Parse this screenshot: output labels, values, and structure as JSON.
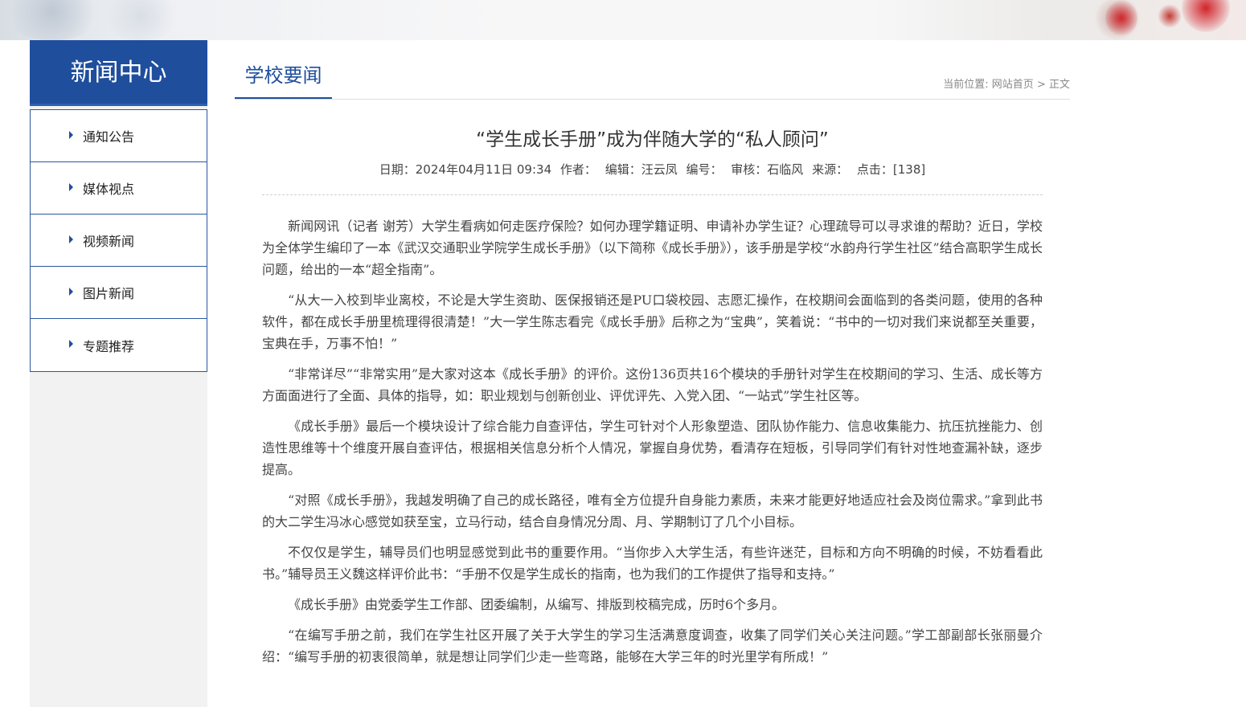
{
  "sidebar": {
    "title": "新闻中心",
    "items": [
      {
        "label": "通知公告"
      },
      {
        "label": "媒体视点"
      },
      {
        "label": "视频新闻"
      },
      {
        "label": "图片新闻"
      },
      {
        "label": "专题推荐"
      }
    ]
  },
  "section": {
    "title": "学校要闻"
  },
  "breadcrumb": {
    "prefix": "当前位置: ",
    "home": "网站首页",
    "separator": " > ",
    "current": "正文"
  },
  "article": {
    "title": "“学生成长手册”成为伴随大学的“私人顾问”",
    "meta": {
      "date": "日期：2024年04月11日 09:34",
      "author": "作者：",
      "editor": "编辑：汪云凤",
      "number": "编号：",
      "reviewer": "审核：石临风",
      "source": "来源：",
      "clicks": "点击：[138]"
    },
    "paragraphs": [
      "新闻网讯（记者 谢芳）大学生看病如何走医疗保险？如何办理学籍证明、申请补办学生证？心理疏导可以寻求谁的帮助？近日，学校为全体学生编印了一本《武汉交通职业学院学生成长手册》（以下简称《成长手册》），该手册是学校“水韵舟行学生社区”结合高职学生成长问题，给出的一本“超全指南”。",
      "“从大一入校到毕业离校，不论是大学生资助、医保报销还是PU口袋校园、志愿汇操作，在校期间会面临到的各类问题，使用的各种软件，都在成长手册里梳理得很清楚！”大一学生陈志看完《成长手册》后称之为“宝典”，笑着说：“书中的一切对我们来说都至关重要，宝典在手，万事不怕！”",
      "“非常详尽”“非常实用”是大家对这本《成长手册》的评价。这份136页共16个模块的手册针对学生在校期间的学习、生活、成长等方方面面进行了全面、具体的指导，如：职业规划与创新创业、评优评先、入党入团、“一站式”学生社区等。",
      "《成长手册》最后一个模块设计了综合能力自查评估，学生可针对个人形象塑造、团队协作能力、信息收集能力、抗压抗挫能力、创造性思维等十个维度开展自查评估，根据相关信息分析个人情况，掌握自身优势，看清存在短板，引导同学们有针对性地查漏补缺，逐步提高。",
      "“对照《成长手册》，我越发明确了自己的成长路径，唯有全方位提升自身能力素质，未来才能更好地适应社会及岗位需求。”拿到此书的大二学生冯冰心感觉如获至宝，立马行动，结合自身情况分周、月、学期制订了几个小目标。",
      "不仅仅是学生，辅导员们也明显感觉到此书的重要作用。“当你步入大学生活，有些许迷茫，目标和方向不明确的时候，不妨看看此书。”辅导员王义魏这样评价此书：“手册不仅是学生成长的指南，也为我们的工作提供了指导和支持。”",
      "《成长手册》由党委学生工作部、团委编制，从编写、排版到校稿完成，历时6个多月。",
      "“在编写手册之前，我们在学生社区开展了关于大学生的学习生活满意度调查，收集了同学们关心关注问题。”学工部副部长张丽曼介绍：“编写手册的初衷很简单，就是想让同学们少走一些弯路，能够在大学三年的时光里学有所成！”"
    ]
  },
  "colors": {
    "brand": "#1f4e9d",
    "sidebar_bg": "#f2f2f2",
    "text": "#444444"
  }
}
